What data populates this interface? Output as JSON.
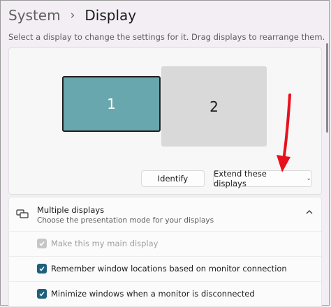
{
  "breadcrumb": {
    "parent": "System",
    "separator": "›",
    "current": "Display"
  },
  "subtitle": "Select a display to change the settings for it. Drag displays to rearrange them.",
  "monitors": [
    {
      "label": "1",
      "selected": true
    },
    {
      "label": "2",
      "selected": false
    }
  ],
  "buttons": {
    "identify": "Identify",
    "extend": "Extend these displays"
  },
  "multiple_displays": {
    "title": "Multiple displays",
    "description": "Choose the presentation mode for your displays",
    "expanded": true,
    "options": [
      {
        "label": "Make this my main display",
        "checked": true,
        "disabled": true
      },
      {
        "label": "Remember window locations based on monitor connection",
        "checked": true,
        "disabled": false
      },
      {
        "label": "Minimize windows when a monitor is disconnected",
        "checked": true,
        "disabled": false
      }
    ]
  },
  "colors": {
    "accent": "#1e5f7d",
    "selected_monitor": "#68a7ae",
    "other_monitor": "#d9d9d9",
    "annotation_arrow": "#e8101b"
  },
  "icons": {
    "breadcrumb_separator": "chevron-right-icon",
    "multiple_displays": "multiple-displays-icon",
    "collapse": "chevron-up-icon",
    "dropdown": "chevron-down-icon"
  }
}
